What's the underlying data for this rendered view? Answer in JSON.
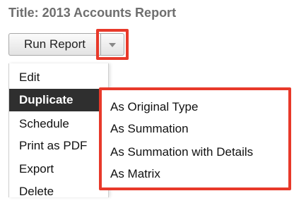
{
  "report": {
    "title": "Title: 2013 Accounts Report"
  },
  "toolbar": {
    "run_report_label": "Run Report",
    "dropdown_icon": "caret-down-icon"
  },
  "actions_menu": {
    "items": [
      {
        "label": "Edit"
      },
      {
        "label": "Duplicate",
        "active": true
      },
      {
        "label": "Schedule"
      },
      {
        "label": "Print as PDF"
      },
      {
        "label": "Export"
      },
      {
        "label": "Delete"
      }
    ]
  },
  "duplicate_submenu": {
    "items": [
      {
        "label": "As Original Type"
      },
      {
        "label": "As Summation"
      },
      {
        "label": "As Summation with Details"
      },
      {
        "label": "As Matrix"
      }
    ]
  },
  "colors": {
    "highlight": "#e8392a",
    "active_item_bg": "#2f2f2f",
    "title_text": "#6e6e6e"
  }
}
